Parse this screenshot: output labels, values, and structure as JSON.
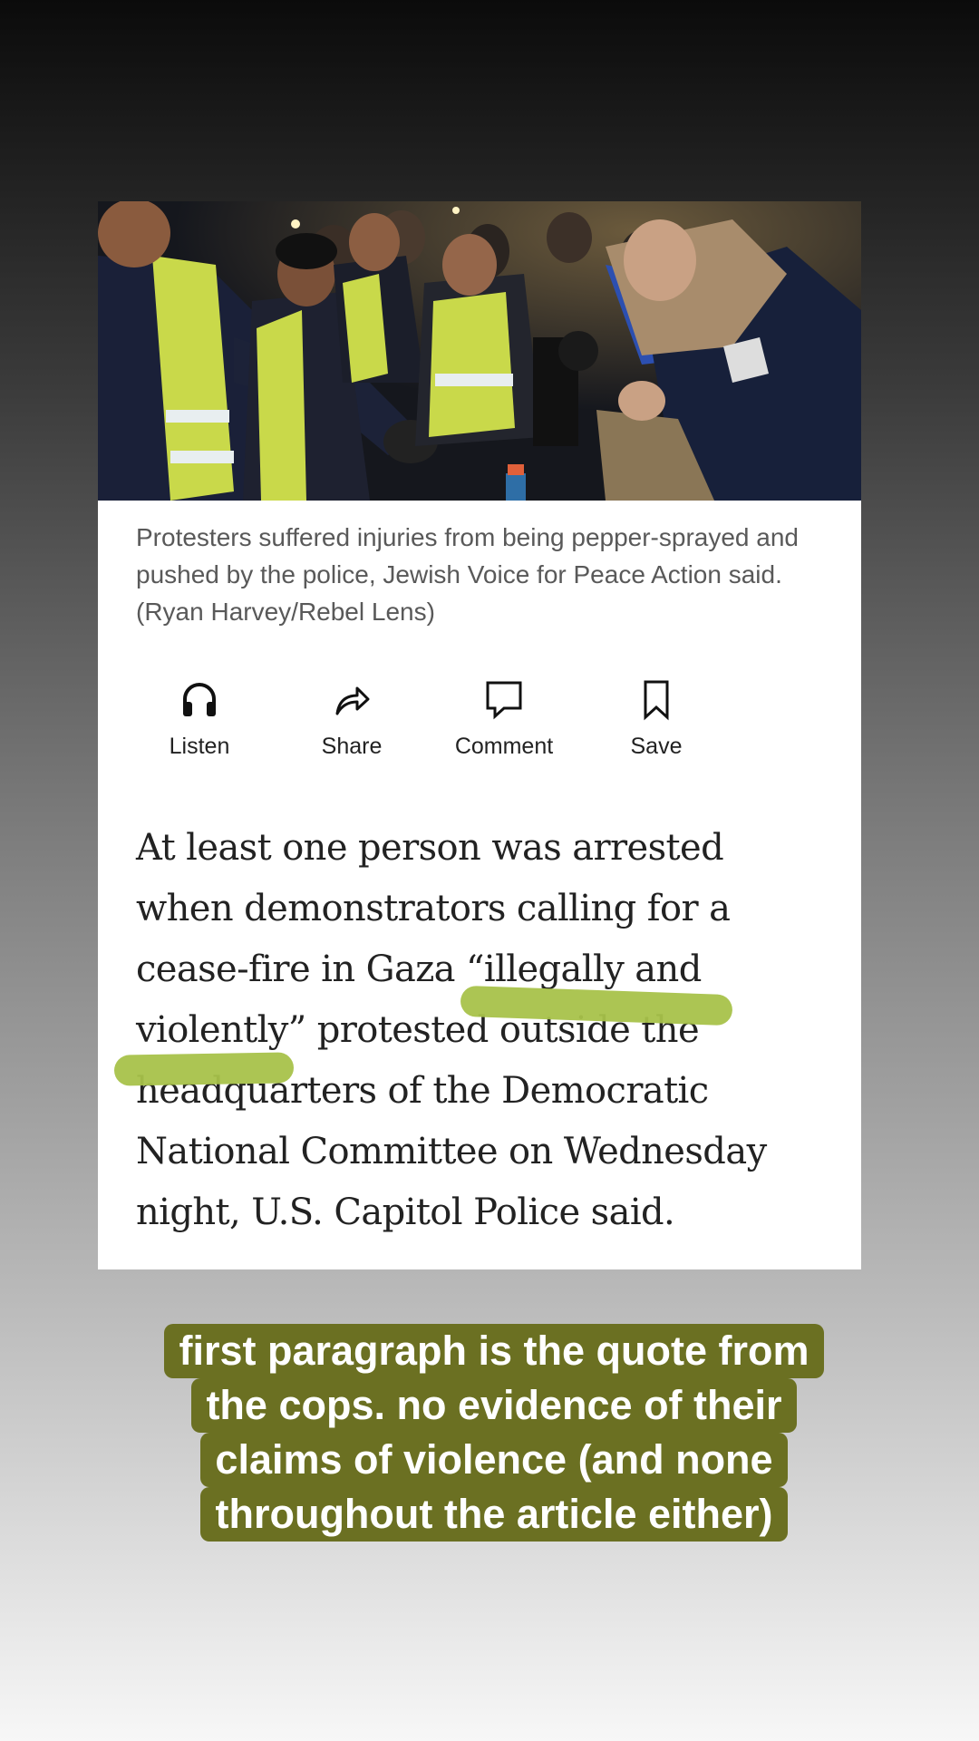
{
  "article": {
    "photo_alt": "Protesters and police at night",
    "caption": "Protesters suffered injuries from being pepper-sprayed and pushed by the police, Jewish Voice for Peace Action said. (Ryan Harvey/Rebel Lens)",
    "actions": [
      {
        "label": "Listen",
        "icon": "headphones-icon"
      },
      {
        "label": "Share",
        "icon": "share-arrow-icon"
      },
      {
        "label": "Comment",
        "icon": "comment-bubble-icon"
      },
      {
        "label": "Save",
        "icon": "bookmark-icon"
      }
    ],
    "body_lines": [
      "At least one person was arrested",
      "when demonstrators calling for a",
      "cease-fire in Gaza “illegally and",
      "violently” protested outside the",
      "headquarters of the Democratic",
      "National Committee on Wednesday",
      "night, U.S. Capitol Police said."
    ],
    "highlight_color": "#a8c24a"
  },
  "overlay": {
    "lines": [
      "first paragraph is the quote from",
      "the cops. no evidence of their",
      "claims of violence (and none",
      "throughout the article either)"
    ],
    "background_color": "#6b7022"
  }
}
